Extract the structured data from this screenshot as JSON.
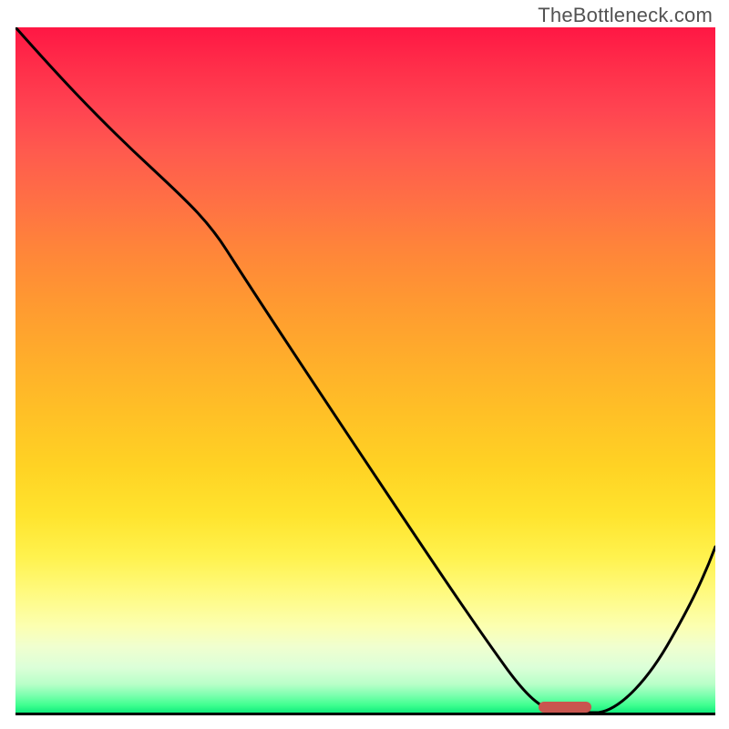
{
  "watermark": "TheBottleneck.com",
  "chart_data": {
    "type": "line",
    "title": "",
    "xlabel": "",
    "ylabel": "",
    "xlim": [
      0,
      100
    ],
    "ylim": [
      0,
      100
    ],
    "x": [
      0,
      12,
      24,
      30,
      40,
      50,
      60,
      68,
      72,
      76,
      80,
      85,
      92,
      100
    ],
    "values": [
      100,
      88,
      76,
      68,
      54,
      40,
      26,
      14,
      7,
      2,
      0,
      0,
      8,
      25
    ],
    "marker": {
      "x_start": 77,
      "x_end": 84,
      "y": 0
    },
    "gradient": "vertical red-to-green",
    "grid": false
  }
}
